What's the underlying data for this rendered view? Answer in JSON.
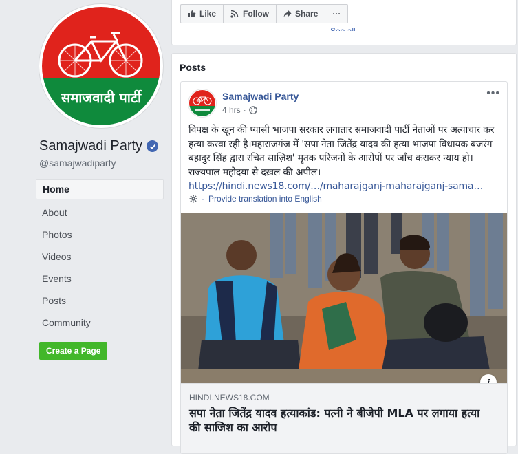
{
  "page": {
    "name": "Samajwadi Party",
    "handle": "@samajwadiparty",
    "logo_text": "समाजवादी पार्टी"
  },
  "sidebar": {
    "items": [
      {
        "label": "Home",
        "active": true
      },
      {
        "label": "About"
      },
      {
        "label": "Photos"
      },
      {
        "label": "Videos"
      },
      {
        "label": "Events"
      },
      {
        "label": "Posts"
      },
      {
        "label": "Community"
      }
    ],
    "create_page": "Create a Page"
  },
  "actions": {
    "like": "Like",
    "follow": "Follow",
    "share": "Share",
    "more": "···",
    "see_all": "See all"
  },
  "posts": {
    "title": "Posts",
    "post": {
      "author": "Samajwadi Party",
      "time": "4 hrs",
      "audience_icon": "globe-icon",
      "more": "•••",
      "text": "विपक्ष के खून की प्यासी भाजपा सरकार लगातार समाजवादी पार्टी नेताओं पर अत्याचार कर हत्या करवा रही है।महाराजगंज में 'सपा नेता जितेंद्र यादव की हत्या भाजपा विधायक बजरंग बहादुर सिंह द्वारा रचित साज़िश' मृतक परिजनों के आरोपों पर जाँच कराकर न्याय हो। राज्यपाल महोदया से दख़ल की अपील।",
      "link": "https://hindi.news18.com/…/maharajganj-maharajganj-samajwad…",
      "translate": "Provide translation into English",
      "preview": {
        "domain": "HINDI.NEWS18.COM",
        "title": "सपा नेता जितेंद्र यादव हत्याकांड: पत्नी ने बीजेपी MLA पर लगाया हत्या की साजिश का आरोप",
        "info": "i"
      }
    }
  },
  "colors": {
    "logo_red": "#e0231c",
    "logo_green": "#0f8a3c",
    "brand_blue": "#4267b2",
    "link_blue": "#385898",
    "create_green": "#42b72a"
  }
}
